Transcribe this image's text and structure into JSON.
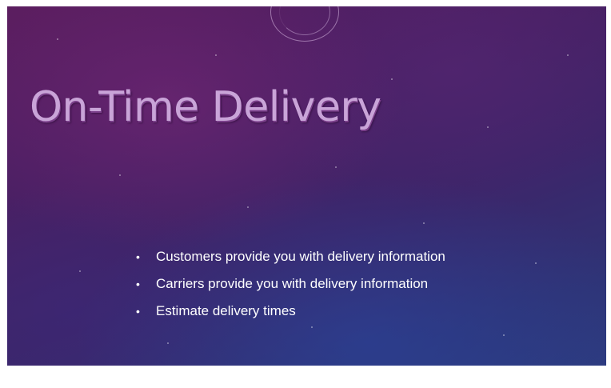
{
  "slide": {
    "title": "On-Time Delivery",
    "bullets": [
      "Customers provide you with delivery information",
      "Carriers provide you with delivery information",
      "Estimate delivery times"
    ],
    "bullet_glyph": "•"
  },
  "colors": {
    "title": "#c9a4d8",
    "title_shadow": "#7a3f8a",
    "bullet_text": "#ffffff",
    "background_top": "#5a1d5e",
    "background_bottom": "#2d3a7d"
  }
}
